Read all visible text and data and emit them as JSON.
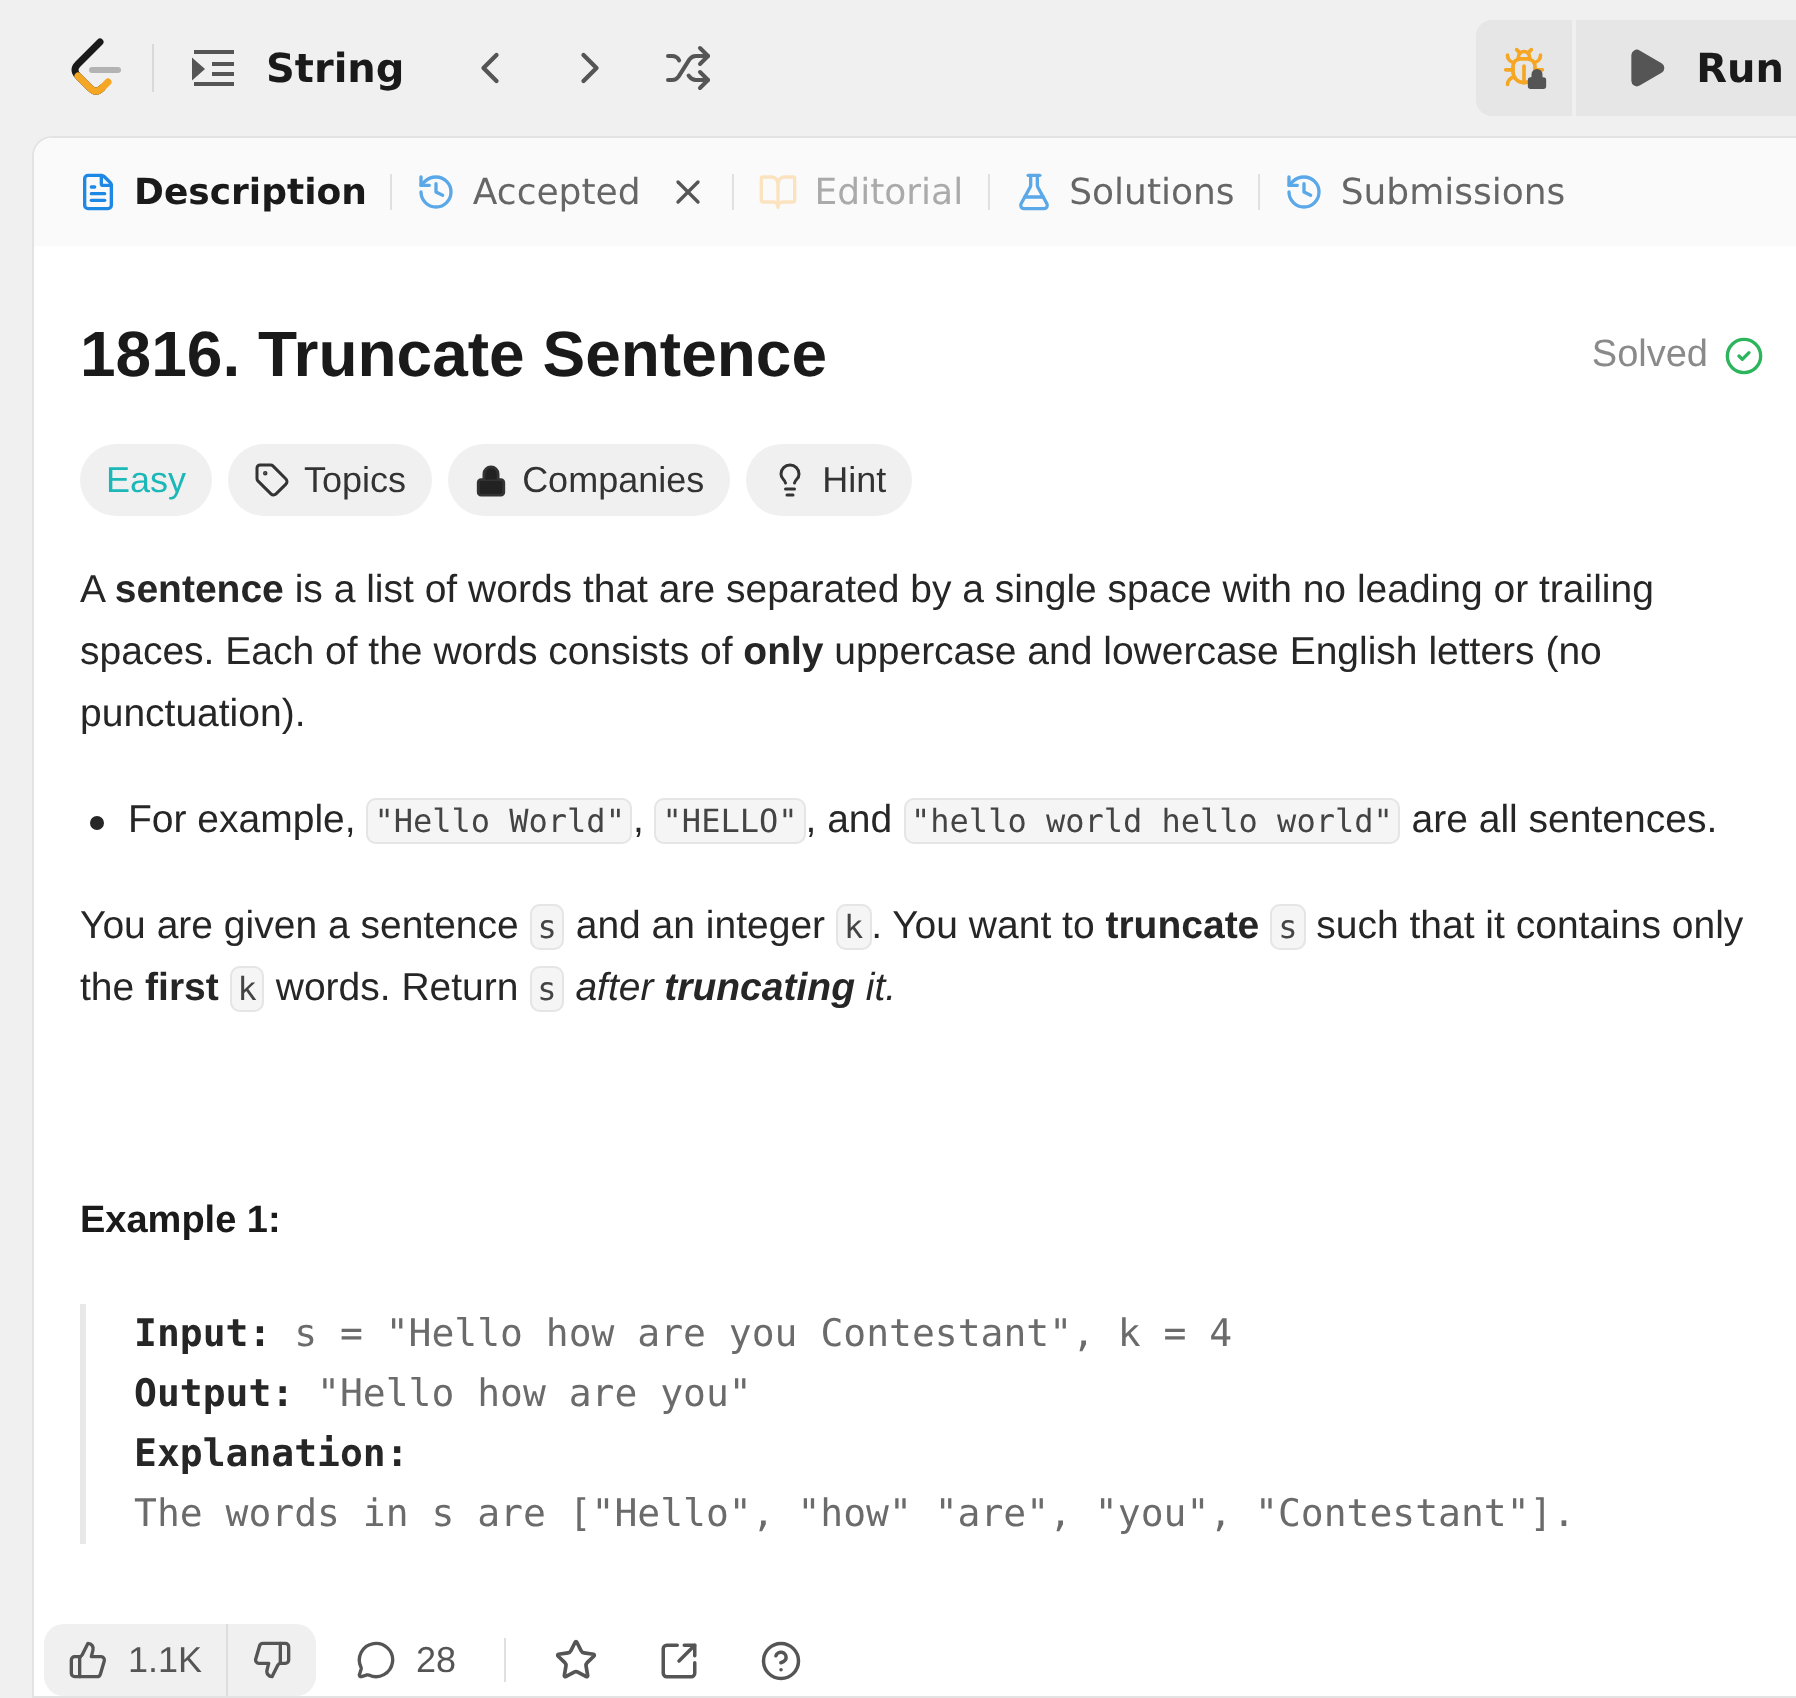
{
  "topbar": {
    "list_title": "String",
    "run_button": "Run",
    "debug_locked": true
  },
  "tabs": [
    {
      "label": "Description",
      "kind": "description",
      "selected": true,
      "disabled": false,
      "closable": false
    },
    {
      "label": "Accepted",
      "kind": "history",
      "selected": false,
      "disabled": false,
      "closable": true
    },
    {
      "label": "Editorial",
      "kind": "book",
      "selected": false,
      "disabled": true,
      "closable": false
    },
    {
      "label": "Solutions",
      "kind": "flask",
      "selected": false,
      "disabled": false,
      "closable": false
    },
    {
      "label": "Submissions",
      "kind": "history",
      "selected": false,
      "disabled": false,
      "closable": false
    }
  ],
  "problem": {
    "title": "1816. Truncate Sentence",
    "status": "Solved",
    "solved": true,
    "tags": [
      {
        "label": "Easy",
        "kind": "difficulty"
      },
      {
        "label": "Topics",
        "kind": "topics"
      },
      {
        "label": "Companies",
        "kind": "companies"
      },
      {
        "label": "Hint",
        "kind": "hint"
      }
    ],
    "paragraphs": [
      {
        "kind": "text",
        "segments": [
          {
            "kind": "text",
            "text": "A **sentence** is a list of words that are separated by a single space with no leading or trailing spaces. Each of the words consists of **only** uppercase and lowercase English letters (no punctuation)."
          }
        ]
      },
      {
        "kind": "bullet",
        "segments": [
          {
            "kind": "text",
            "text": "For example, "
          },
          {
            "kind": "code",
            "text": "\"Hello World\""
          },
          {
            "kind": "text",
            "text": ", "
          },
          {
            "kind": "code",
            "text": "\"HELLO\""
          },
          {
            "kind": "text",
            "text": ", and "
          },
          {
            "kind": "code",
            "text": "\"hello world hello world\""
          },
          {
            "kind": "text",
            "text": " are all sentences."
          }
        ]
      },
      {
        "kind": "text",
        "segments": [
          {
            "kind": "text",
            "text": "You are given a sentence "
          },
          {
            "kind": "code",
            "text": "s"
          },
          {
            "kind": "text",
            "text": " and an integer "
          },
          {
            "kind": "code",
            "text": "k"
          },
          {
            "kind": "text",
            "text": ". You want to **truncate** "
          },
          {
            "kind": "code",
            "text": "s"
          },
          {
            "kind": "text",
            "text": " such that it contains only the **first** "
          },
          {
            "kind": "code",
            "text": "k"
          },
          {
            "kind": "text",
            "text": " words. Return "
          },
          {
            "kind": "code",
            "text": "s"
          },
          {
            "kind": "italic",
            "text": " after **truncating** it."
          }
        ]
      }
    ],
    "examples": [
      {
        "heading": "Example 1:",
        "lines": [
          {
            "label": "Input:",
            "value": "s = \"Hello how are you Contestant\", k = 4"
          },
          {
            "label": "Output:",
            "value": "\"Hello how are you\""
          },
          {
            "label": "Explanation:"
          },
          {
            "value": "The words in s are [\"Hello\", \"how\" \"are\", \"you\", \"Contestant\"]."
          }
        ]
      }
    ]
  },
  "footer": {
    "likes": "1.1K",
    "comments": "28"
  }
}
